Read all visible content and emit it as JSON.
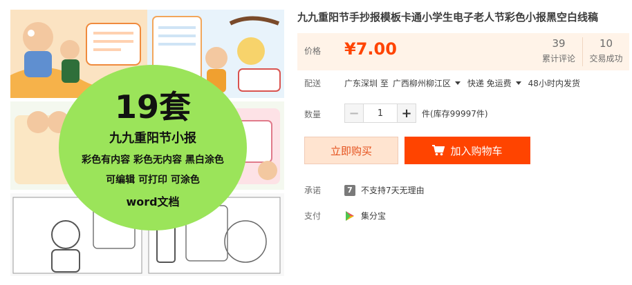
{
  "product": {
    "title": "九九重阳节手抄报模板卡通小学生电子老人节彩色小报黑空白线稿"
  },
  "gallery": {
    "overlay": {
      "count": "19套",
      "line1": "九九重阳节小报",
      "line2": "彩色有内容 彩色无内容 黑白涂色",
      "line3": "可编辑 可打印 可涂色",
      "line4": "word文档"
    },
    "bubble_color": "#9be45a"
  },
  "price": {
    "label": "价格",
    "value": "¥7.00",
    "color": "#ff4400"
  },
  "stats": {
    "reviews_count": "39",
    "reviews_label": "累计评论",
    "sales_count": "10",
    "sales_label": "交易成功"
  },
  "shipping": {
    "label": "配送",
    "from": "广东深圳 至",
    "to": "广西柳州柳江区",
    "method": "快递 免运费",
    "time": "48小时内发货"
  },
  "quantity": {
    "label": "数量",
    "minus": "−",
    "value": "1",
    "plus": "+",
    "stock": "件(库存99997件)"
  },
  "actions": {
    "buy_now": "立即购买",
    "add_to_cart": "加入购物车"
  },
  "promise": {
    "label": "承诺",
    "icon_text": "7",
    "text": "不支持7天无理由"
  },
  "payment": {
    "label": "支付",
    "method": "集分宝"
  }
}
